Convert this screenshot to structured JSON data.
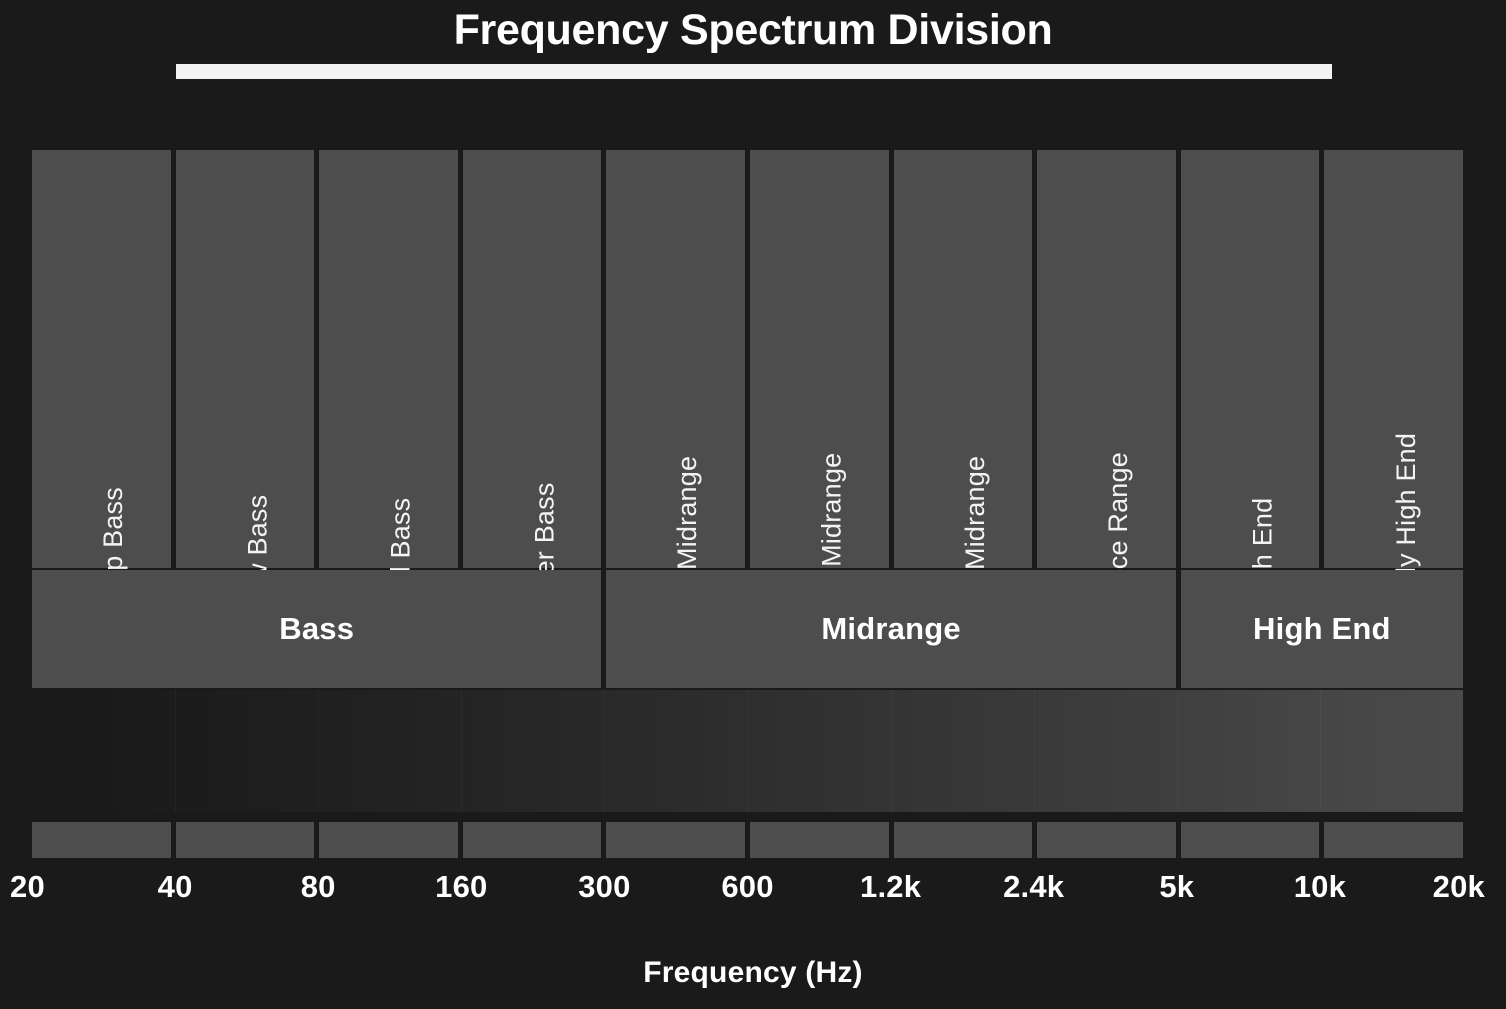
{
  "title": "Frequency Spectrum Division",
  "axis_title": "Frequency (Hz)",
  "colors": {
    "background": "#1a1a1a",
    "band_fill": "#4d4d4d",
    "text": "#ffffff",
    "accent_bar": "#f2f2f2",
    "gradient_start": "#191919",
    "gradient_end": "#4a4a4a"
  },
  "chart_data": {
    "type": "bar",
    "title": "Frequency Spectrum Division",
    "xlabel": "Frequency (Hz)",
    "ylabel": "",
    "grid": false,
    "legend": "none",
    "axis_scale": "log",
    "tick_labels": [
      "20",
      "40",
      "80",
      "160",
      "300",
      "600",
      "1.2k",
      "2.4k",
      "5k",
      "10k",
      "20k"
    ],
    "tick_values": [
      20,
      40,
      80,
      160,
      300,
      600,
      1200,
      2400,
      5000,
      10000,
      20000
    ],
    "categories": [
      "Deep Bass",
      "Low Bass",
      "Mid Bass",
      "Upper Bass",
      "Lower Midrange",
      "Middle Midrange",
      "Upper Midrange",
      "Presence Range",
      "High End",
      "Extremely High End"
    ],
    "bands": [
      {
        "label": "Deep Bass",
        "from": "20",
        "to": "40",
        "group": "Bass"
      },
      {
        "label": "Low Bass",
        "from": "40",
        "to": "80",
        "group": "Bass"
      },
      {
        "label": "Mid Bass",
        "from": "80",
        "to": "160",
        "group": "Bass"
      },
      {
        "label": "Upper Bass",
        "from": "160",
        "to": "300",
        "group": "Bass"
      },
      {
        "label": "Lower Midrange",
        "from": "300",
        "to": "600",
        "group": "Midrange"
      },
      {
        "label": "Middle Midrange",
        "from": "600",
        "to": "1.2k",
        "group": "Midrange"
      },
      {
        "label": "Upper Midrange",
        "from": "1.2k",
        "to": "2.4k",
        "group": "Midrange"
      },
      {
        "label": "Presence Range",
        "from": "2.4k",
        "to": "5k",
        "group": "Midrange"
      },
      {
        "label": "High End",
        "from": "5k",
        "to": "10k",
        "group": "High End"
      },
      {
        "label": "Extremely High End",
        "from": "10k",
        "to": "20k",
        "group": "High End"
      }
    ],
    "groups": [
      {
        "label": "Bass",
        "span": 4,
        "from": "20",
        "to": "300"
      },
      {
        "label": "Midrange",
        "span": 4,
        "from": "300",
        "to": "5k"
      },
      {
        "label": "High End",
        "span": 2,
        "from": "5k",
        "to": "20k"
      }
    ]
  }
}
